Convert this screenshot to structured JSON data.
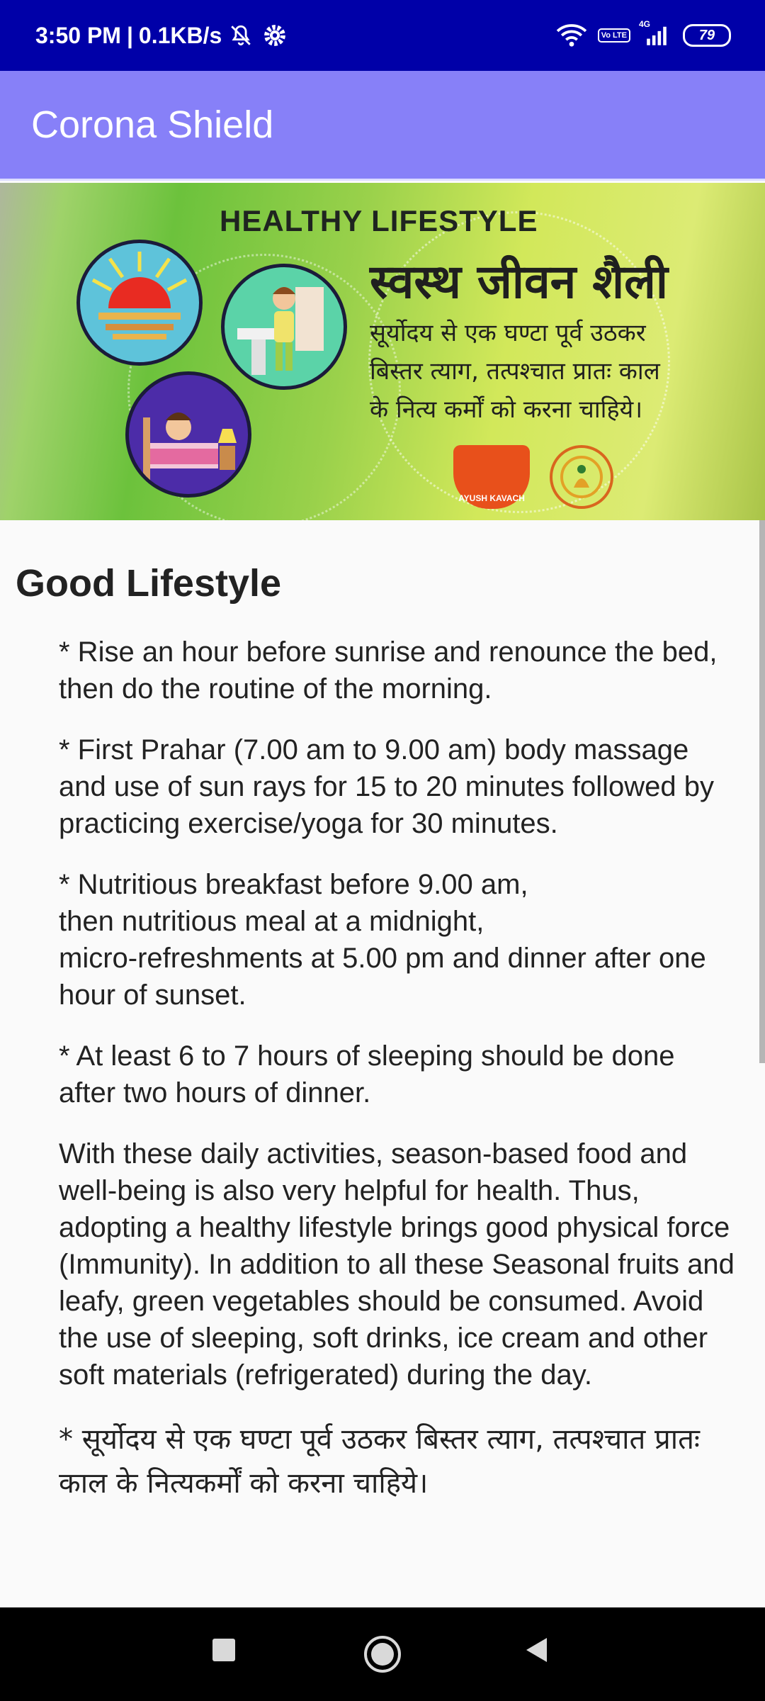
{
  "status_bar": {
    "time": "3:50 PM",
    "separator": "|",
    "speed": "0.1KB/s",
    "network": "4G",
    "volte_label": "Vo LTE",
    "battery": "79",
    "icons": [
      "mute-icon",
      "settings-icon",
      "wifi-icon",
      "volte-icon",
      "signal-icon",
      "battery-icon"
    ]
  },
  "app_bar": {
    "title": "Corona Shield",
    "color": "#8780f8"
  },
  "banner": {
    "title": "HEALTHY LIFESTYLE",
    "hindi_title": "स्वस्थ जीवन शैली",
    "hindi_lines": [
      "सूर्योदय से एक घण्टा पूर्व उठकर",
      "बिस्तर त्याग, तत्पश्चात प्रातः काल",
      "के नित्य कर्मों को करना चाहिये।"
    ],
    "logo_text": "AYUSH KAVACH"
  },
  "content": {
    "heading": "Good Lifestyle",
    "paragraphs": [
      "* Rise an hour before sunrise and renounce the bed, then do the routine of the morning.",
      "* First Prahar (7.00 am to 9.00 am) body massage and use of sun rays for 15 to 20 minutes followed by practicing exercise/yoga for 30 minutes.",
      "* Nutritious breakfast before 9.00 am,\nthen nutritious meal at a midnight,\nmicro-refreshments at 5.00 pm and dinner after one hour of sunset.",
      "* At least 6 to 7 hours of sleeping should be done after two hours of dinner.",
      "With these daily activities, season-based food and well-being is also very helpful for health. Thus, adopting a healthy lifestyle brings good physical force (Immunity). In addition to all these Seasonal fruits and leafy, green vegetables should be consumed. Avoid the use of sleeping, soft drinks, ice cream and other soft materials (refrigerated) during the day."
    ],
    "hindi_paragraph": "* सूर्योदय से एक घण्टा पूर्व उठकर बिस्तर त्याग, तत्पश्चात प्रातः काल के नित्यकर्मों को करना चाहिये।"
  },
  "nav_bar": {
    "buttons": [
      "recents-button",
      "home-button",
      "back-button"
    ]
  }
}
